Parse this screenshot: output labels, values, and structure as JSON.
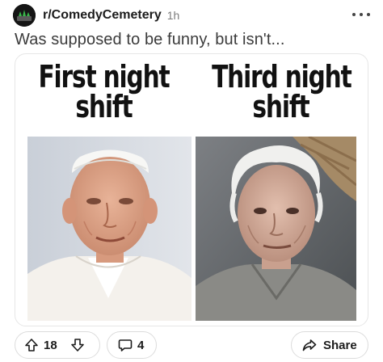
{
  "post": {
    "subreddit": "r/ComedyCemetery",
    "time": "1h",
    "title": "Was supposed to be funny, but isn't...",
    "more_icon": "more-horizontal-icon"
  },
  "meme": {
    "left_caption": [
      "First night",
      "shift"
    ],
    "right_caption": [
      "Third night",
      "shift"
    ],
    "left_photo": "elderly man in white cap and white vestments",
    "right_photo": "elderly man with white hair in gray rough tunic"
  },
  "actions": {
    "upvotes": "18",
    "comments": "4",
    "share_label": "Share",
    "icons": [
      "upvote-arrow-icon",
      "downvote-arrow-icon",
      "comment-bubble-icon",
      "share-arrow-icon"
    ]
  },
  "colors": {
    "text": "#1c1c1c",
    "muted": "#7c7c7c",
    "border": "#dcdcdc"
  }
}
